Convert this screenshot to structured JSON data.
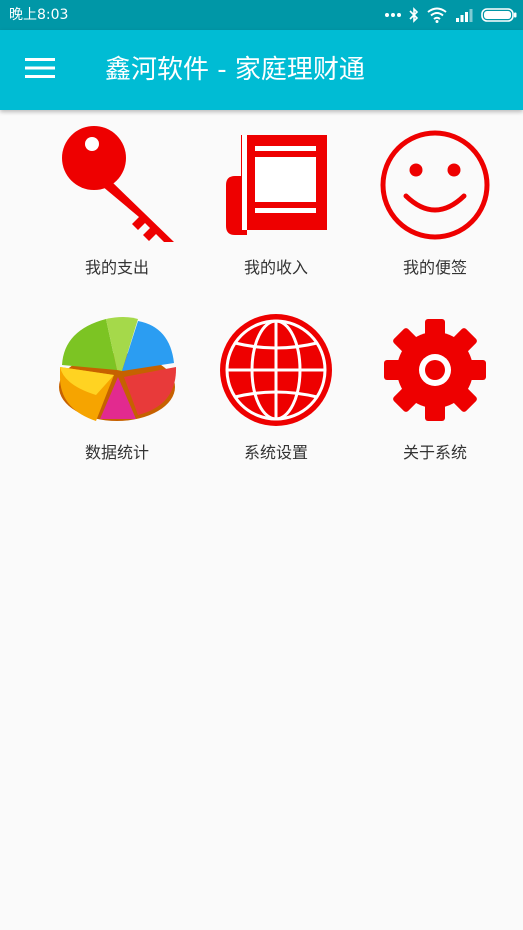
{
  "status_bar": {
    "time": "晚上8:03",
    "background": "#0097a7",
    "icons": [
      "more-dots-icon",
      "bluetooth-icon",
      "wifi-icon",
      "signal-icon",
      "battery-icon"
    ]
  },
  "app_bar": {
    "title": "鑫河软件 - 家庭理财通",
    "menu_icon": "hamburger-menu-icon",
    "background": "#00bcd4"
  },
  "grid": {
    "items": [
      {
        "label": "我的支出",
        "icon": "key-icon"
      },
      {
        "label": "我的收入",
        "icon": "ledger-icon"
      },
      {
        "label": "我的便签",
        "icon": "smiley-icon"
      },
      {
        "label": "数据统计",
        "icon": "pie-chart-icon"
      },
      {
        "label": "系统设置",
        "icon": "globe-icon"
      },
      {
        "label": "关于系统",
        "icon": "gear-icon"
      }
    ]
  },
  "colors": {
    "icon_red": "#ee0000",
    "page_background": "#fafafa",
    "label_text": "#333333"
  }
}
